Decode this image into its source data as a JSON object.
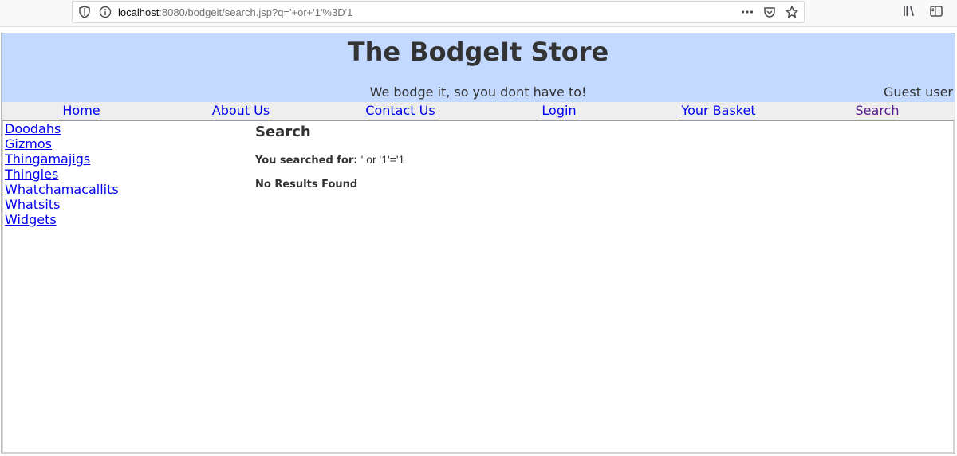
{
  "browser": {
    "url_host": "localhost",
    "url_rest": ":8080/bodgeit/search.jsp?q='+or+'1'%3D'1",
    "icons": [
      "shield-icon",
      "info-icon",
      "more-icon",
      "pocket-icon",
      "star-icon",
      "library-icon",
      "sidebar-icon"
    ]
  },
  "header": {
    "title": "The BodgeIt Store",
    "tagline": "We bodge it, so you dont have to!",
    "user": "Guest user"
  },
  "nav": [
    {
      "label": "Home"
    },
    {
      "label": "About Us"
    },
    {
      "label": "Contact Us"
    },
    {
      "label": "Login"
    },
    {
      "label": "Your Basket"
    },
    {
      "label": "Search"
    }
  ],
  "categories": [
    "Doodahs",
    "Gizmos",
    "Thingamajigs",
    "Thingies",
    "Whatchamacallits",
    "Whatsits",
    "Widgets"
  ],
  "main": {
    "heading": "Search",
    "searched_label": "You searched for:",
    "query": "' or '1'='1",
    "no_results": "No Results Found"
  },
  "colors": {
    "header_bg": "#c3d9ff",
    "nav_bg": "#eeeeee",
    "link": "#0000ee",
    "visited": "#551a8b"
  }
}
